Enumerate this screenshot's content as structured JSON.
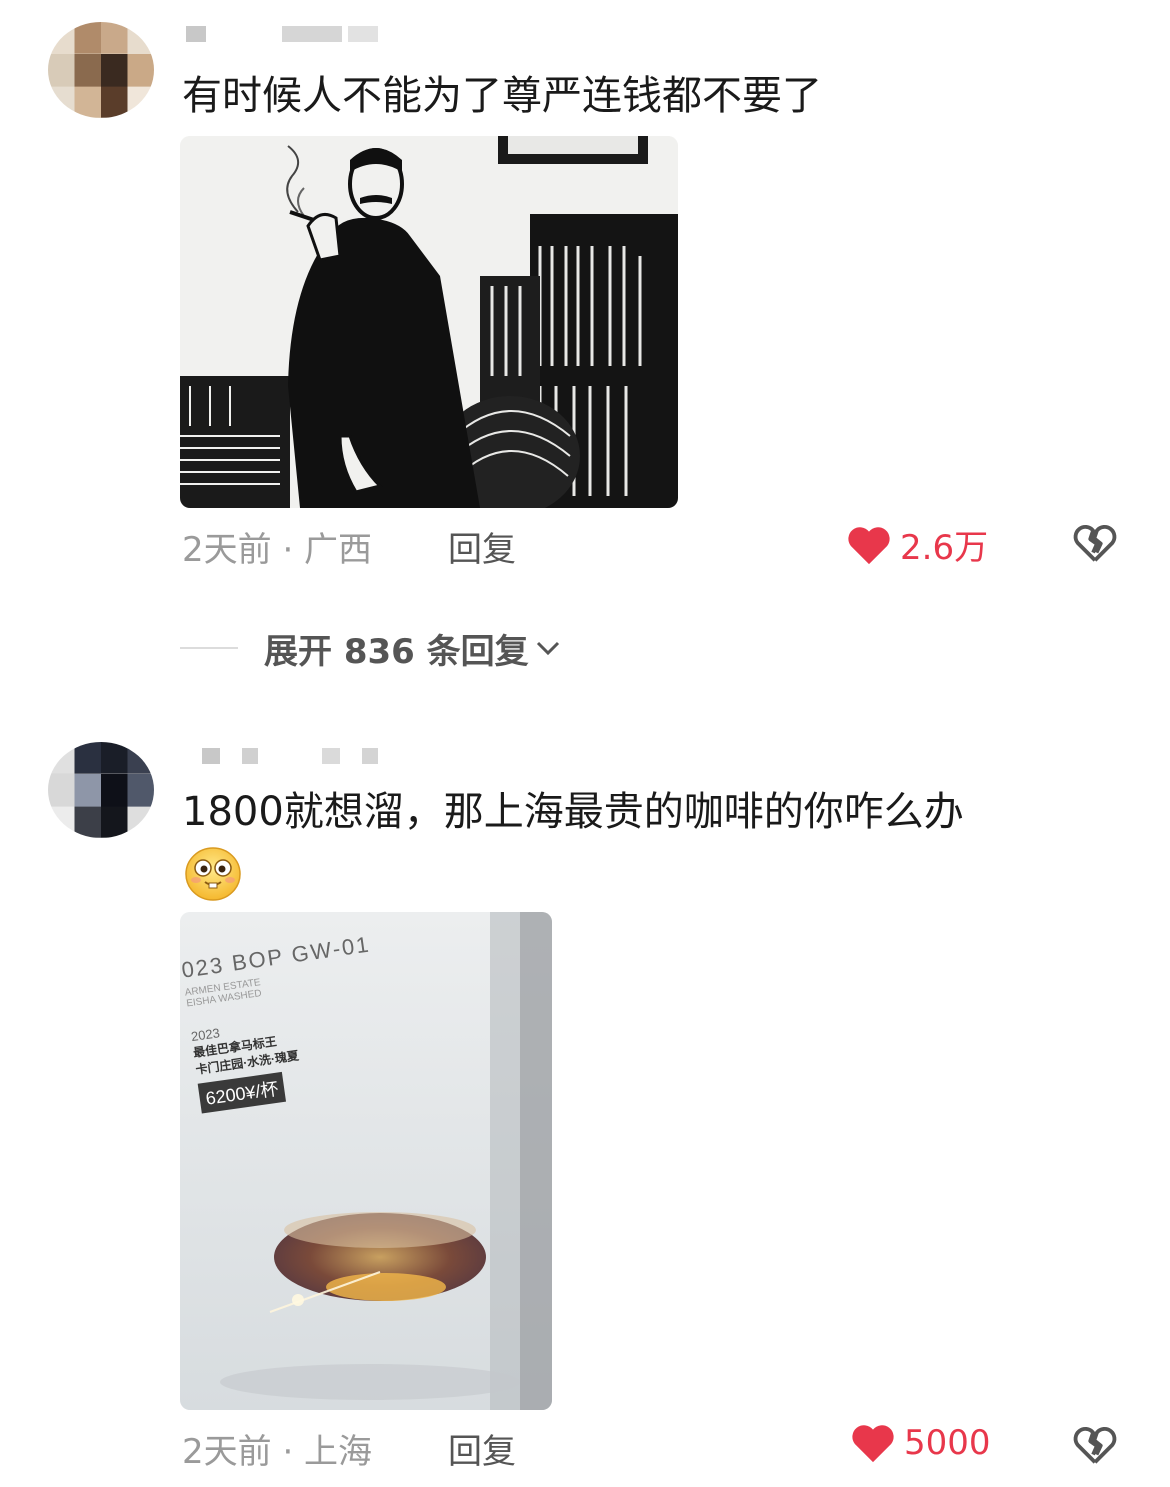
{
  "comments": [
    {
      "text": "有时候人不能为了尊严连钱都不要了",
      "meta": "2天前 · 广西",
      "reply_label": "回复",
      "like_count": "2.6万",
      "image_icon": "woodcut-portrait-icon"
    },
    {
      "text": "1800就想溜，那上海最贵的咖啡的你咋么办",
      "meta": "2天前 · 上海",
      "reply_label": "回复",
      "like_count": "5000",
      "emoji_icon": "smiling-face-emoji-icon",
      "image_card": {
        "title": "023 BOP GW-01",
        "sub1": "ARMEN ESTATE",
        "sub2": "EISHA WASHED",
        "year": "2023",
        "line1": "最佳巴拿马标王",
        "line2": "卡门庄园·水洗·瑰夏",
        "price": "6200¥/杯"
      }
    }
  ],
  "expand_replies_label": "展开 836 条回复",
  "colors": {
    "like": "#e8374b",
    "meta": "#9a9a9a",
    "text": "#1a1a1a"
  }
}
